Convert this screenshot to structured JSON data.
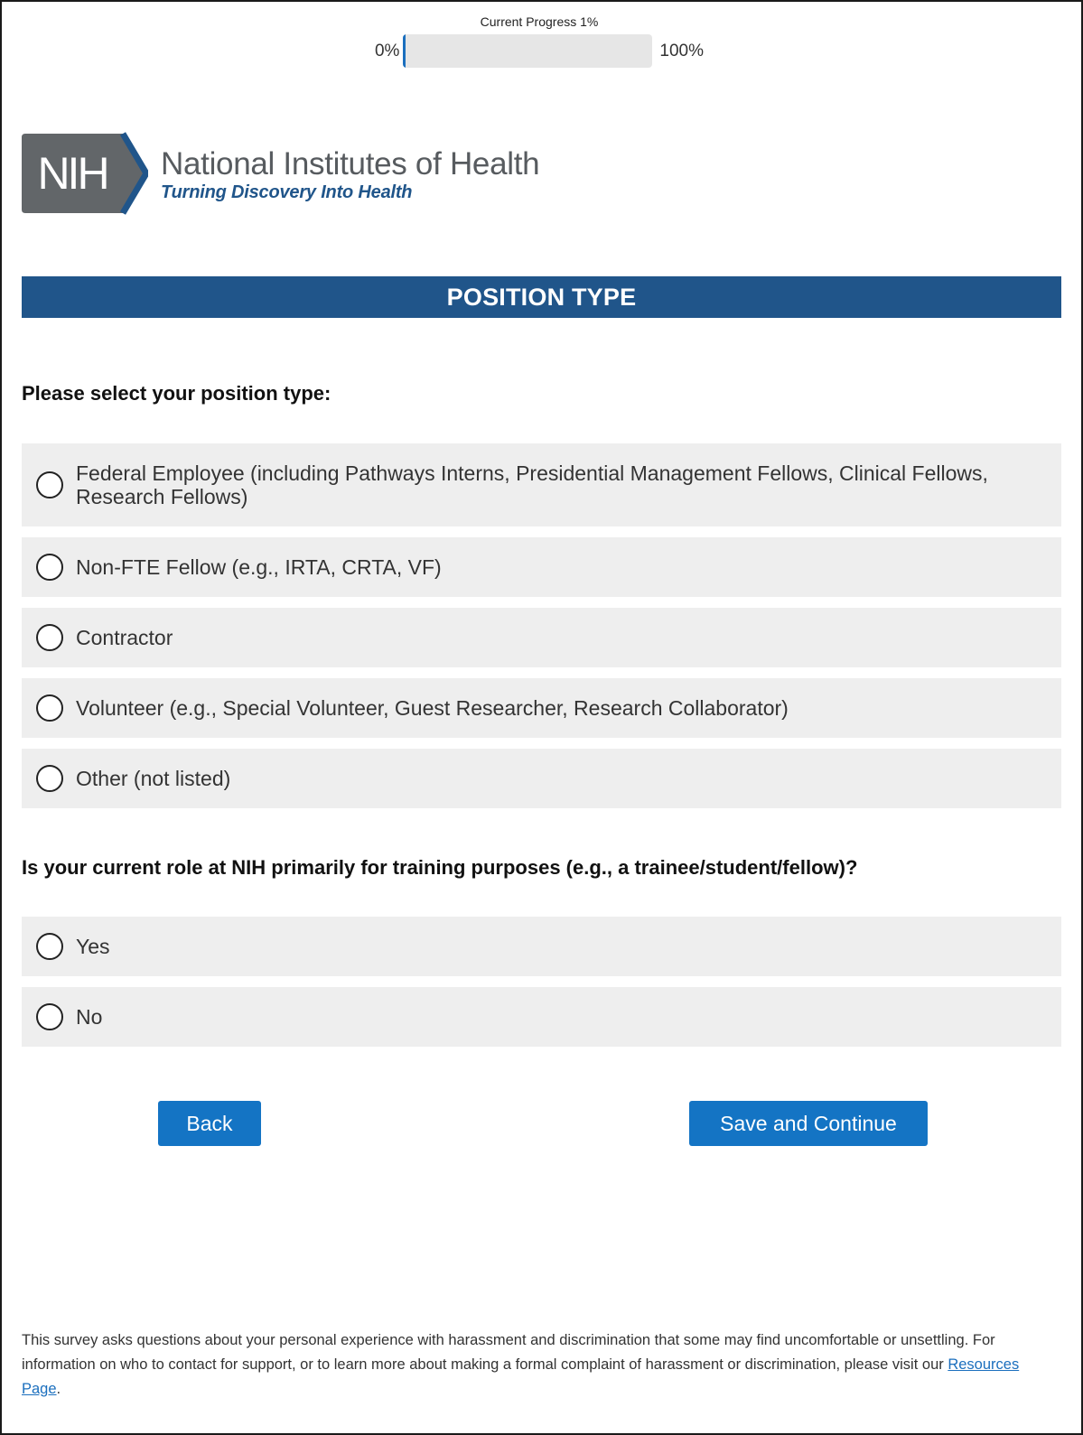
{
  "progress": {
    "title": "Current Progress 1%",
    "min_label": "0%",
    "max_label": "100%",
    "value_percent": 1,
    "fill_color": "#1b6fbe"
  },
  "logo": {
    "mark_text": "NIH",
    "name": "National Institutes of Health",
    "tagline": "Turning Discovery Into Health"
  },
  "section": {
    "title": "POSITION TYPE",
    "color": "#20558a"
  },
  "question1": {
    "text": "Please select your position type:",
    "options": [
      {
        "label": "Federal Employee (including Pathways Interns, Presidential Management Fellows, Clinical Fellows, Research Fellows)",
        "selected": false
      },
      {
        "label": "Non-FTE Fellow (e.g., IRTA, CRTA, VF)",
        "selected": false
      },
      {
        "label": "Contractor",
        "selected": false
      },
      {
        "label": "Volunteer (e.g., Special Volunteer, Guest Researcher, Research Collaborator)",
        "selected": false
      },
      {
        "label": "Other (not listed)",
        "selected": false
      }
    ]
  },
  "question2": {
    "text": "Is your current role at NIH primarily for training purposes (e.g., a trainee/student/fellow)?",
    "options": [
      {
        "label": "Yes",
        "selected": false
      },
      {
        "label": "No",
        "selected": false
      }
    ]
  },
  "buttons": {
    "back": "Back",
    "save": "Save and Continue",
    "color": "#1474c4"
  },
  "footer": {
    "text": "This survey asks questions about your personal experience with harassment and discrimination that some may find uncomfortable or unsettling. For information on who to contact for support, or to learn more about making a formal complaint of harassment or discrimination, please visit our ",
    "link_text": "Resources Page",
    "trailing": "."
  }
}
